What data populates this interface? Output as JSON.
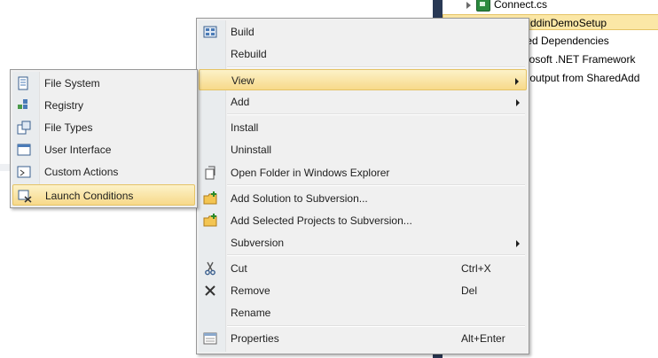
{
  "solution_explorer": {
    "rows": [
      {
        "text": "Connect.cs",
        "icon": "cs-file-icon"
      },
      {
        "text": "ddinDemoSetup",
        "selected": true
      },
      {
        "text": "cted Dependencies"
      },
      {
        "text": "icrosoft .NET Framework"
      },
      {
        "text": "ry output from SharedAdd"
      }
    ]
  },
  "context_menu": {
    "items": [
      {
        "label": "Build",
        "icon": "build-icon"
      },
      {
        "label": "Rebuild"
      },
      {
        "label": "View",
        "submenu": true,
        "highlighted": true
      },
      {
        "label": "Add",
        "submenu": true
      },
      {
        "label": "Install"
      },
      {
        "label": "Uninstall"
      },
      {
        "label": "Open Folder in Windows Explorer",
        "icon": "open-folder-icon"
      },
      {
        "label": "Add Solution to Subversion...",
        "icon": "add-solution-subversion-icon"
      },
      {
        "label": "Add Selected Projects to Subversion...",
        "icon": "add-projects-subversion-icon"
      },
      {
        "label": "Subversion",
        "submenu": true
      },
      {
        "label": "Cut",
        "shortcut": "Ctrl+X",
        "icon": "scissors-icon"
      },
      {
        "label": "Remove",
        "shortcut": "Del",
        "icon": "x-remove-icon"
      },
      {
        "label": "Rename"
      },
      {
        "label": "Properties",
        "shortcut": "Alt+Enter",
        "icon": "properties-icon"
      }
    ]
  },
  "view_submenu": {
    "items": [
      {
        "label": "File System",
        "icon": "file-system-editor-icon"
      },
      {
        "label": "Registry",
        "icon": "registry-editor-icon"
      },
      {
        "label": "File Types",
        "icon": "file-types-editor-icon"
      },
      {
        "label": "User Interface",
        "icon": "user-interface-editor-icon"
      },
      {
        "label": "Custom Actions",
        "icon": "custom-actions-editor-icon"
      },
      {
        "label": "Launch Conditions",
        "icon": "launch-conditions-editor-icon",
        "highlighted": true
      }
    ]
  },
  "colors": {
    "menu_background": "#f0f0f0",
    "highlight": "#f7d98a",
    "highlight_border": "#e5c365",
    "panel_bar": "#293955"
  }
}
